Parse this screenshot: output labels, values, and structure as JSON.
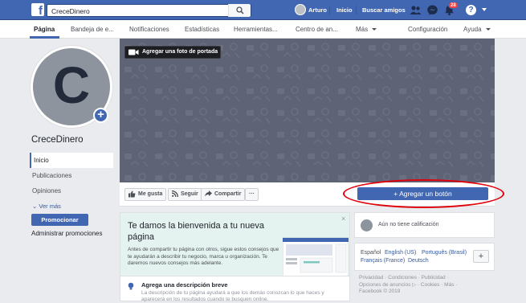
{
  "topbar": {
    "search_value": "CreceDinero",
    "user_name": "Arturo",
    "home_label": "Inicio",
    "find_friends_label": "Buscar amigos",
    "notification_count": "28"
  },
  "page_nav": {
    "tabs": [
      {
        "label": "Página"
      },
      {
        "label": "Bandeja de e..."
      },
      {
        "label": "Notificaciones"
      },
      {
        "label": "Estadísticas"
      },
      {
        "label": "Herramientas..."
      },
      {
        "label": "Centro de an..."
      },
      {
        "label": "Más"
      },
      {
        "label": "Configuración"
      },
      {
        "label": "Ayuda"
      }
    ]
  },
  "profile": {
    "letter": "C",
    "page_name": "CreceDinero"
  },
  "left_nav": {
    "items": [
      {
        "label": "Inicio"
      },
      {
        "label": "Publicaciones"
      },
      {
        "label": "Opiniones"
      }
    ],
    "more_label": "Ver más",
    "promote_label": "Promocionar",
    "manage_promotions_label": "Administrar promociones"
  },
  "cover": {
    "add_cover_label": "Agregar una foto de portada"
  },
  "actions": {
    "like_label": "Me gusta",
    "follow_label": "Seguir",
    "share_label": "Compartir",
    "more_label": "···",
    "add_button_label": "+ Agregar un botón"
  },
  "welcome": {
    "title": "Te damos la bienvenida a tu nueva página",
    "close": "×",
    "description": "Antes de compartir tu página con otros, sigue estos consejos que te ayudarán a describir tu negocio, marca u organización. Te daremos nuevos consejos más adelante.",
    "tip_title": "Agrega una descripción breve",
    "tip_text": "La descripción de tu página ayudará a que los demás conozcan lo que haces y aparecerá en los resultados cuando te busquen online."
  },
  "sidebar": {
    "rating_text": "Aún no tiene calificación",
    "language_current": "Español",
    "languages": [
      "English (US)",
      "Português (Brasil)",
      "Français (France)",
      "Deutsch"
    ],
    "footer": {
      "links_row1": "Privacidad · Condiciones · Publicidad ·",
      "links_row2": "Opciones de anuncios ▷ · Cookies · Más ·",
      "copyright": "Facebook © 2019"
    }
  },
  "colors": {
    "brand_blue": "#4267b2",
    "cover_gray": "#5e6475",
    "annotation_red": "#e0000a"
  }
}
